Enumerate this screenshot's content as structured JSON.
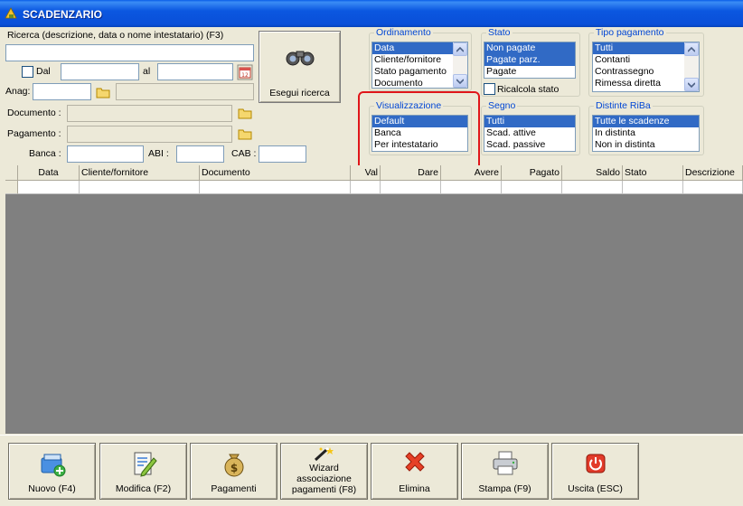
{
  "window": {
    "title": "SCADENZARIO"
  },
  "search": {
    "label": "Ricerca (descrizione, data o nome intestatario) (F3)",
    "value": "",
    "dal_label": "Dal",
    "al_label": "al",
    "anag_label": "Anag:",
    "documento_label": "Documento :",
    "pagamento_label": "Pagamento :",
    "banca_label": "Banca :",
    "abi_label": "ABI :",
    "cab_label": "CAB :",
    "search_button": "Esegui ricerca"
  },
  "ordinamento": {
    "legend": "Ordinamento",
    "options": [
      "Data",
      "Cliente/fornitore",
      "Stato pagamento",
      "Documento"
    ],
    "selected": "Data"
  },
  "stato": {
    "legend": "Stato",
    "options": [
      "Non pagate",
      "Pagate parz.",
      "Pagate"
    ],
    "selected": [
      "Non pagate",
      "Pagate parz."
    ],
    "ricalcola_label": "Ricalcola stato"
  },
  "tipo_pagamento": {
    "legend": "Tipo pagamento",
    "options": [
      "Tutti",
      "Contanti",
      "Contrassegno",
      "Rimessa diretta"
    ],
    "selected": "Tutti"
  },
  "visualizzazione": {
    "legend": "Visualizzazione",
    "options": [
      "Default",
      "Banca",
      "Per intestatario"
    ],
    "selected": "Default"
  },
  "segno": {
    "legend": "Segno",
    "options": [
      "Tutti",
      "Scad. attive",
      "Scad. passive"
    ],
    "selected": "Tutti"
  },
  "distinte": {
    "legend": "Distinte RiBa",
    "options": [
      "Tutte le scadenze",
      "In distinta",
      "Non in distinta"
    ],
    "selected": "Tutte le scadenze"
  },
  "grid": {
    "columns": [
      "Data",
      "Cliente/fornitore",
      "Documento",
      "Val",
      "Dare",
      "Avere",
      "Pagato",
      "Saldo",
      "Stato",
      "Descrizione"
    ]
  },
  "toolbar": {
    "nuovo": "Nuovo (F4)",
    "modifica": "Modifica (F2)",
    "pagamenti": "Pagamenti",
    "wizard": "Wizard associazione pagamenti (F8)",
    "elimina": "Elimina",
    "stampa": "Stampa (F9)",
    "uscita": "Uscita (ESC)"
  },
  "colors": {
    "selection": "#316ac5",
    "legend": "#0046d5",
    "highlight": "#e0161a",
    "titlebar": "#0a4fd8"
  }
}
